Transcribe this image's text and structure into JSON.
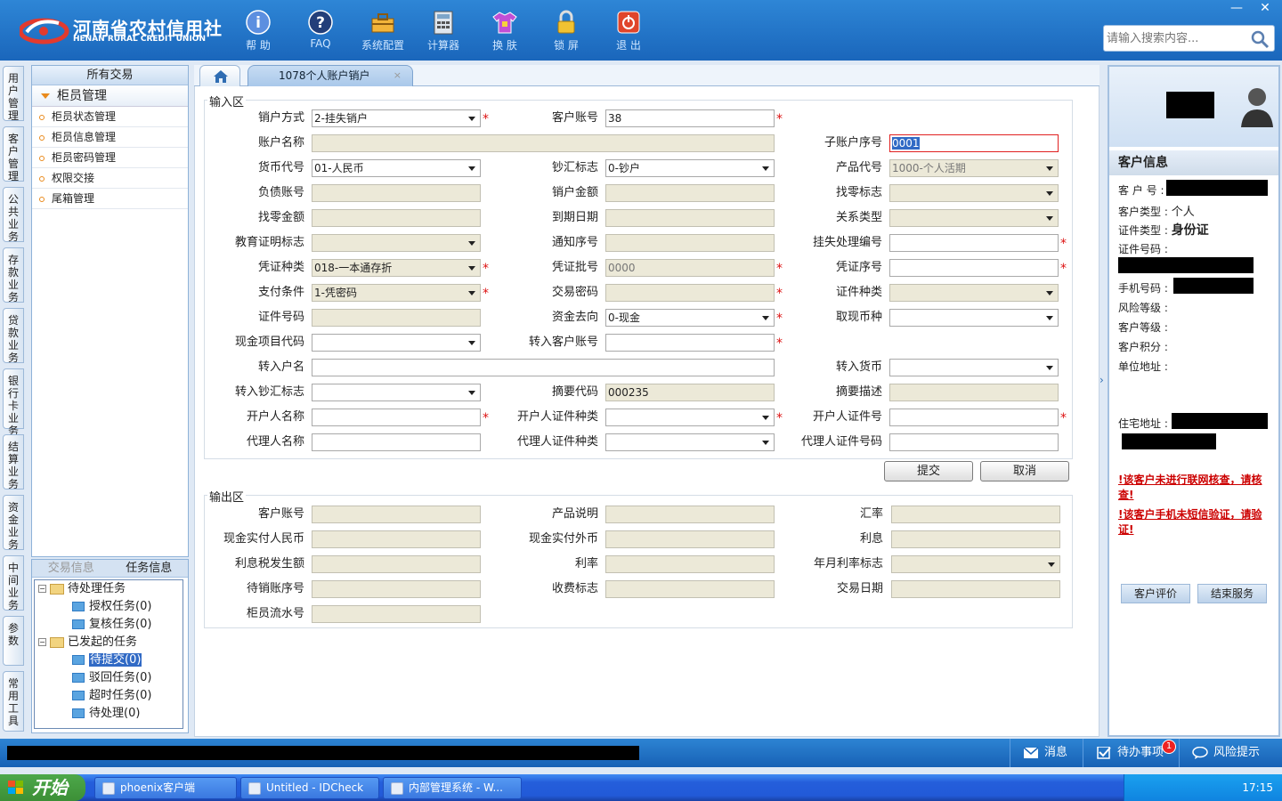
{
  "brand": {
    "cn": "河南省农村信用社",
    "en": "HENAN RURAL CREDIT UNION"
  },
  "toolbar": [
    {
      "id": "help",
      "label": "帮 助",
      "icon": "help-icon"
    },
    {
      "id": "faq",
      "label": "FAQ",
      "icon": "faq-icon"
    },
    {
      "id": "config",
      "label": "系统配置",
      "icon": "toolbox-icon"
    },
    {
      "id": "calc",
      "label": "计算器",
      "icon": "calculator-icon"
    },
    {
      "id": "skin",
      "label": "换 肤",
      "icon": "shirt-icon"
    },
    {
      "id": "lock",
      "label": "锁 屏",
      "icon": "lock-icon"
    },
    {
      "id": "exit",
      "label": "退 出",
      "icon": "power-icon"
    }
  ],
  "search": {
    "placeholder": "请输入搜索内容..."
  },
  "window_controls": {
    "minimize": "—",
    "close": "✕"
  },
  "left_tabs": [
    "用户管理",
    "客户管理",
    "公共业务",
    "存款业务",
    "贷款业务",
    "银行卡业务",
    "结算业务",
    "资金业务",
    "中间业务",
    "参数",
    "常用工具"
  ],
  "menu": {
    "header": "所有交易",
    "group": "柜员管理",
    "items": [
      "柜员状态管理",
      "柜员信息管理",
      "柜员密码管理",
      "权限交接",
      "尾箱管理"
    ]
  },
  "tasks": {
    "tabs": [
      "交易信息",
      "任务信息"
    ],
    "tree": {
      "pending": "待处理任务",
      "auth": "授权任务(0)",
      "review": "复核任务(0)",
      "started": "已发起的任务",
      "to_submit": "待提交(0)",
      "rejected": "驳回任务(0)",
      "overtime": "超时任务(0)",
      "to_process": "待处理(0)"
    }
  },
  "tab": {
    "title": "1078个人账户销户",
    "close": "×"
  },
  "input_area": {
    "title": "输入区",
    "fields": {
      "cancel_method": {
        "label": "销户方式",
        "value": "2-挂失销户"
      },
      "customer_account": {
        "label": "客户账号",
        "value": "38"
      },
      "account_name": {
        "label": "账户名称",
        "value": ""
      },
      "sub_account_no": {
        "label": "子账户序号",
        "value": "0001"
      },
      "currency_code": {
        "label": "货币代号",
        "value": "01-人民币"
      },
      "cash_remit_flag": {
        "label": "钞汇标志",
        "value": "0-钞户"
      },
      "product_code": {
        "label": "产品代号",
        "value": "1000-个人活期"
      },
      "liability_account": {
        "label": "负债账号",
        "value": ""
      },
      "cancel_amount": {
        "label": "销户金额",
        "value": ""
      },
      "change_flag": {
        "label": "找零标志",
        "value": ""
      },
      "change_amount": {
        "label": "找零金额",
        "value": ""
      },
      "due_date": {
        "label": "到期日期",
        "value": ""
      },
      "relation_type": {
        "label": "关系类型",
        "value": ""
      },
      "edu_cert_flag": {
        "label": "教育证明标志",
        "value": ""
      },
      "notice_no": {
        "label": "通知序号",
        "value": ""
      },
      "loss_handle_no": {
        "label": "挂失处理编号",
        "value": ""
      },
      "voucher_type": {
        "label": "凭证种类",
        "value": "018-一本通存折"
      },
      "voucher_batch": {
        "label": "凭证批号",
        "value": "0000"
      },
      "voucher_no": {
        "label": "凭证序号",
        "value": ""
      },
      "pay_condition": {
        "label": "支付条件",
        "value": "1-凭密码"
      },
      "trade_password": {
        "label": "交易密码",
        "value": ""
      },
      "id_type": {
        "label": "证件种类",
        "value": ""
      },
      "id_no": {
        "label": "证件号码",
        "value": ""
      },
      "fund_direction": {
        "label": "资金去向",
        "value": "0-现金"
      },
      "cash_currency": {
        "label": "取现币种",
        "value": ""
      },
      "cash_item_code": {
        "label": "现金项目代码",
        "value": ""
      },
      "in_customer_account": {
        "label": "转入客户账号",
        "value": ""
      },
      "in_account_name": {
        "label": "转入户名",
        "value": ""
      },
      "in_currency": {
        "label": "转入货币",
        "value": ""
      },
      "in_cash_remit_flag": {
        "label": "转入钞汇标志",
        "value": ""
      },
      "summary_code": {
        "label": "摘要代码",
        "value": "000235"
      },
      "summary_desc": {
        "label": "摘要描述",
        "value": ""
      },
      "opener_name": {
        "label": "开户人名称",
        "value": ""
      },
      "opener_id_type": {
        "label": "开户人证件种类",
        "value": ""
      },
      "opener_id_no": {
        "label": "开户人证件号",
        "value": ""
      },
      "agent_name": {
        "label": "代理人名称",
        "value": ""
      },
      "agent_id_type": {
        "label": "代理人证件种类",
        "value": ""
      },
      "agent_id_no": {
        "label": "代理人证件号码",
        "value": ""
      }
    },
    "submit": "提交",
    "cancel": "取消"
  },
  "output_area": {
    "title": "输出区",
    "fields": {
      "customer_account": "客户账号",
      "product_desc": "产品说明",
      "exchange_rate": "汇率",
      "cash_rmb": "现金实付人民币",
      "cash_foreign": "现金实付外币",
      "interest": "利息",
      "interest_tax": "利息税发生额",
      "rate": "利率",
      "rate_flag": "年月利率标志",
      "pending_account_no": "待销账序号",
      "fee_flag": "收费标志",
      "trade_date": "交易日期",
      "teller_serial": "柜员流水号"
    }
  },
  "customer": {
    "title": "客户信息",
    "customer_no": "客 户 号 :",
    "customer_type_label": "客户类型 :",
    "customer_type": "个人",
    "id_type_label": "证件类型 :",
    "id_type": "身份证",
    "id_no_label": "证件号码 :",
    "phone_label": "手机号码 :",
    "risk_label": "风险等级 :",
    "level_label": "客户等级 :",
    "points_label": "客户积分 :",
    "company_label": "单位地址 :",
    "home_label": "住宅地址 :",
    "warning1": "!该客户未进行联网核查，请核查!",
    "warning2": "!该客户手机未短信验证，请验证!",
    "rate_btn": "客户评价",
    "end_btn": "结束服务"
  },
  "status": {
    "message": "消息",
    "todo": "待办事项",
    "todo_badge": "1",
    "risk": "风险提示"
  },
  "taskbar": {
    "start": "开始",
    "items": [
      "phoenix客户端",
      "Untitled - IDCheck",
      "内部管理系统 - W..."
    ],
    "time": "17:15"
  },
  "colors": {
    "accent": "#1a66bb",
    "required": "#d11111",
    "warning": "#cc0000"
  }
}
